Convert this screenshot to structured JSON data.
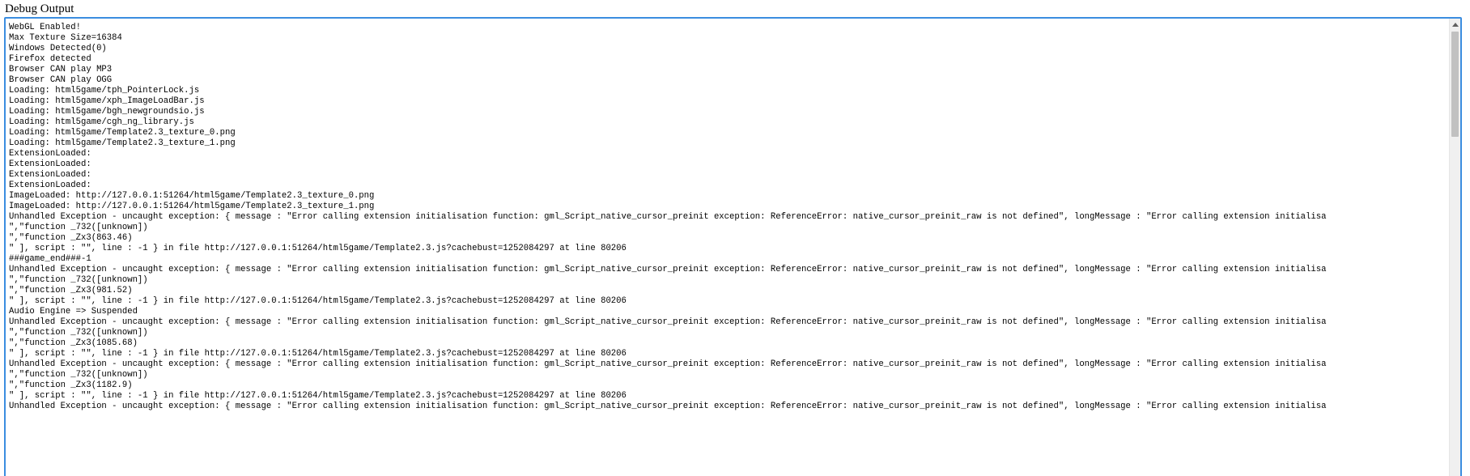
{
  "heading": "Debug Output",
  "log_lines": [
    "WebGL Enabled!",
    "Max Texture Size=16384",
    "Windows Detected(0)",
    "Firefox detected",
    "Browser CAN play MP3",
    "Browser CAN play OGG",
    "Loading: html5game/tph_PointerLock.js",
    "Loading: html5game/xph_ImageLoadBar.js",
    "Loading: html5game/bgh_newgroundsio.js",
    "Loading: html5game/cgh_ng_library.js",
    "Loading: html5game/Template2.3_texture_0.png",
    "Loading: html5game/Template2.3_texture_1.png",
    "ExtensionLoaded:",
    "ExtensionLoaded:",
    "ExtensionLoaded:",
    "ExtensionLoaded:",
    "ImageLoaded: http://127.0.0.1:51264/html5game/Template2.3_texture_0.png",
    "ImageLoaded: http://127.0.0.1:51264/html5game/Template2.3_texture_1.png",
    "Unhandled Exception - uncaught exception: { message : \"Error calling extension initialisation function: gml_Script_native_cursor_preinit exception: ReferenceError: native_cursor_preinit_raw is not defined\", longMessage : \"Error calling extension initialisa",
    "\",\"function _732([unknown])",
    "\",\"function _Zx3(863.46)",
    "\" ], script : \"\", line : -1 } in file http://127.0.0.1:51264/html5game/Template2.3.js?cachebust=1252084297 at line 80206",
    "###game_end###-1",
    "Unhandled Exception - uncaught exception: { message : \"Error calling extension initialisation function: gml_Script_native_cursor_preinit exception: ReferenceError: native_cursor_preinit_raw is not defined\", longMessage : \"Error calling extension initialisa",
    "\",\"function _732([unknown])",
    "\",\"function _Zx3(981.52)",
    "\" ], script : \"\", line : -1 } in file http://127.0.0.1:51264/html5game/Template2.3.js?cachebust=1252084297 at line 80206",
    "Audio Engine => Suspended",
    "Unhandled Exception - uncaught exception: { message : \"Error calling extension initialisation function: gml_Script_native_cursor_preinit exception: ReferenceError: native_cursor_preinit_raw is not defined\", longMessage : \"Error calling extension initialisa",
    "\",\"function _732([unknown])",
    "\",\"function _Zx3(1085.68)",
    "\" ], script : \"\", line : -1 } in file http://127.0.0.1:51264/html5game/Template2.3.js?cachebust=1252084297 at line 80206",
    "Unhandled Exception - uncaught exception: { message : \"Error calling extension initialisation function: gml_Script_native_cursor_preinit exception: ReferenceError: native_cursor_preinit_raw is not defined\", longMessage : \"Error calling extension initialisa",
    "\",\"function _732([unknown])",
    "\",\"function _Zx3(1182.9)",
    "\" ], script : \"\", line : -1 } in file http://127.0.0.1:51264/html5game/Template2.3.js?cachebust=1252084297 at line 80206",
    "Unhandled Exception - uncaught exception: { message : \"Error calling extension initialisation function: gml_Script_native_cursor_preinit exception: ReferenceError: native_cursor_preinit_raw is not defined\", longMessage : \"Error calling extension initialisa"
  ]
}
